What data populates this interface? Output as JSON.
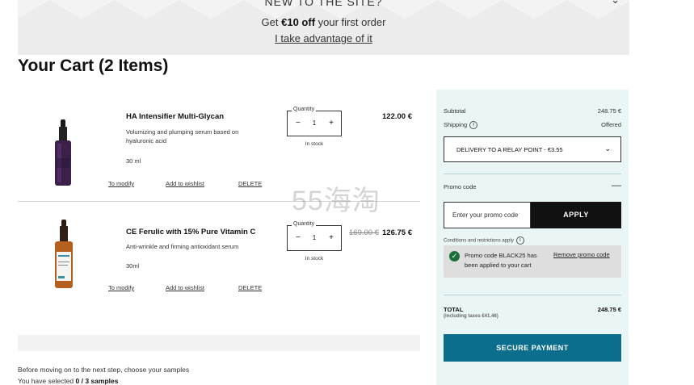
{
  "banner": {
    "title": "NEW TO THE SITE?",
    "offer_prefix": "Get ",
    "offer_amount": "€10 off",
    "offer_suffix": " your first order",
    "link": "I take advantage of it",
    "chevron": "⌄"
  },
  "cart": {
    "title": "Your Cart (2 Items)",
    "items": [
      {
        "name": "HA Intensifier Multi-Glycan",
        "description": "Volumizing and plumping serum based on hyaluronic acid",
        "size": "30 ml",
        "quantity_label": "Quantity",
        "quantity": "1",
        "stock": "In stock",
        "price": "122.00 €",
        "old_price": "",
        "actions": {
          "modify": "To modify",
          "wishlist": "Add to wishlist",
          "delete": "DELETE"
        },
        "image": "purple-serum-bottle"
      },
      {
        "name": "CE Ferulic with 15% Pure Vitamin C",
        "description": "Anti-wrinkle and firming antioxidant serum",
        "size": "30ml",
        "quantity_label": "Quantity",
        "quantity": "1",
        "stock": "In stock",
        "price": "126.75 €",
        "old_price": "169.00 €",
        "actions": {
          "modify": "To modify",
          "wishlist": "Add to wishlist",
          "delete": "DELETE"
        },
        "image": "amber-serum-bottle"
      }
    ],
    "qty_minus": "−",
    "qty_plus": "+"
  },
  "watermark": "55海淘",
  "samples": {
    "prompt": "Before moving on to the next step, choose your samples",
    "selected_prefix": "You have selected ",
    "selected_count": "0 / 3 samples"
  },
  "summary": {
    "subtotal_label": "Subtotal",
    "subtotal_value": "248.75 €",
    "shipping_label": "Shipping",
    "shipping_value": "Offered",
    "delivery_option": "DELIVERY TO A RELAY POINT - €3.55",
    "promo_label": "Promo code",
    "promo_toggle": "—",
    "promo_placeholder": "Enter your promo code",
    "apply_label": "APPLY",
    "conditions": "Conditions and restrictions apply",
    "applied_message": "Promo code BLACK25 has been applied to your cart",
    "remove_link": "Remove promo code",
    "total_label": "TOTAL",
    "total_sub": "(including taxes €41.46)",
    "total_value": "248.75 €",
    "pay_label": "SECURE PAYMENT"
  },
  "colors": {
    "summary_bg": "#e9f6f5",
    "pay_button": "#0b6e8c",
    "apply_button": "#111111",
    "check": "#1a6f3c"
  }
}
